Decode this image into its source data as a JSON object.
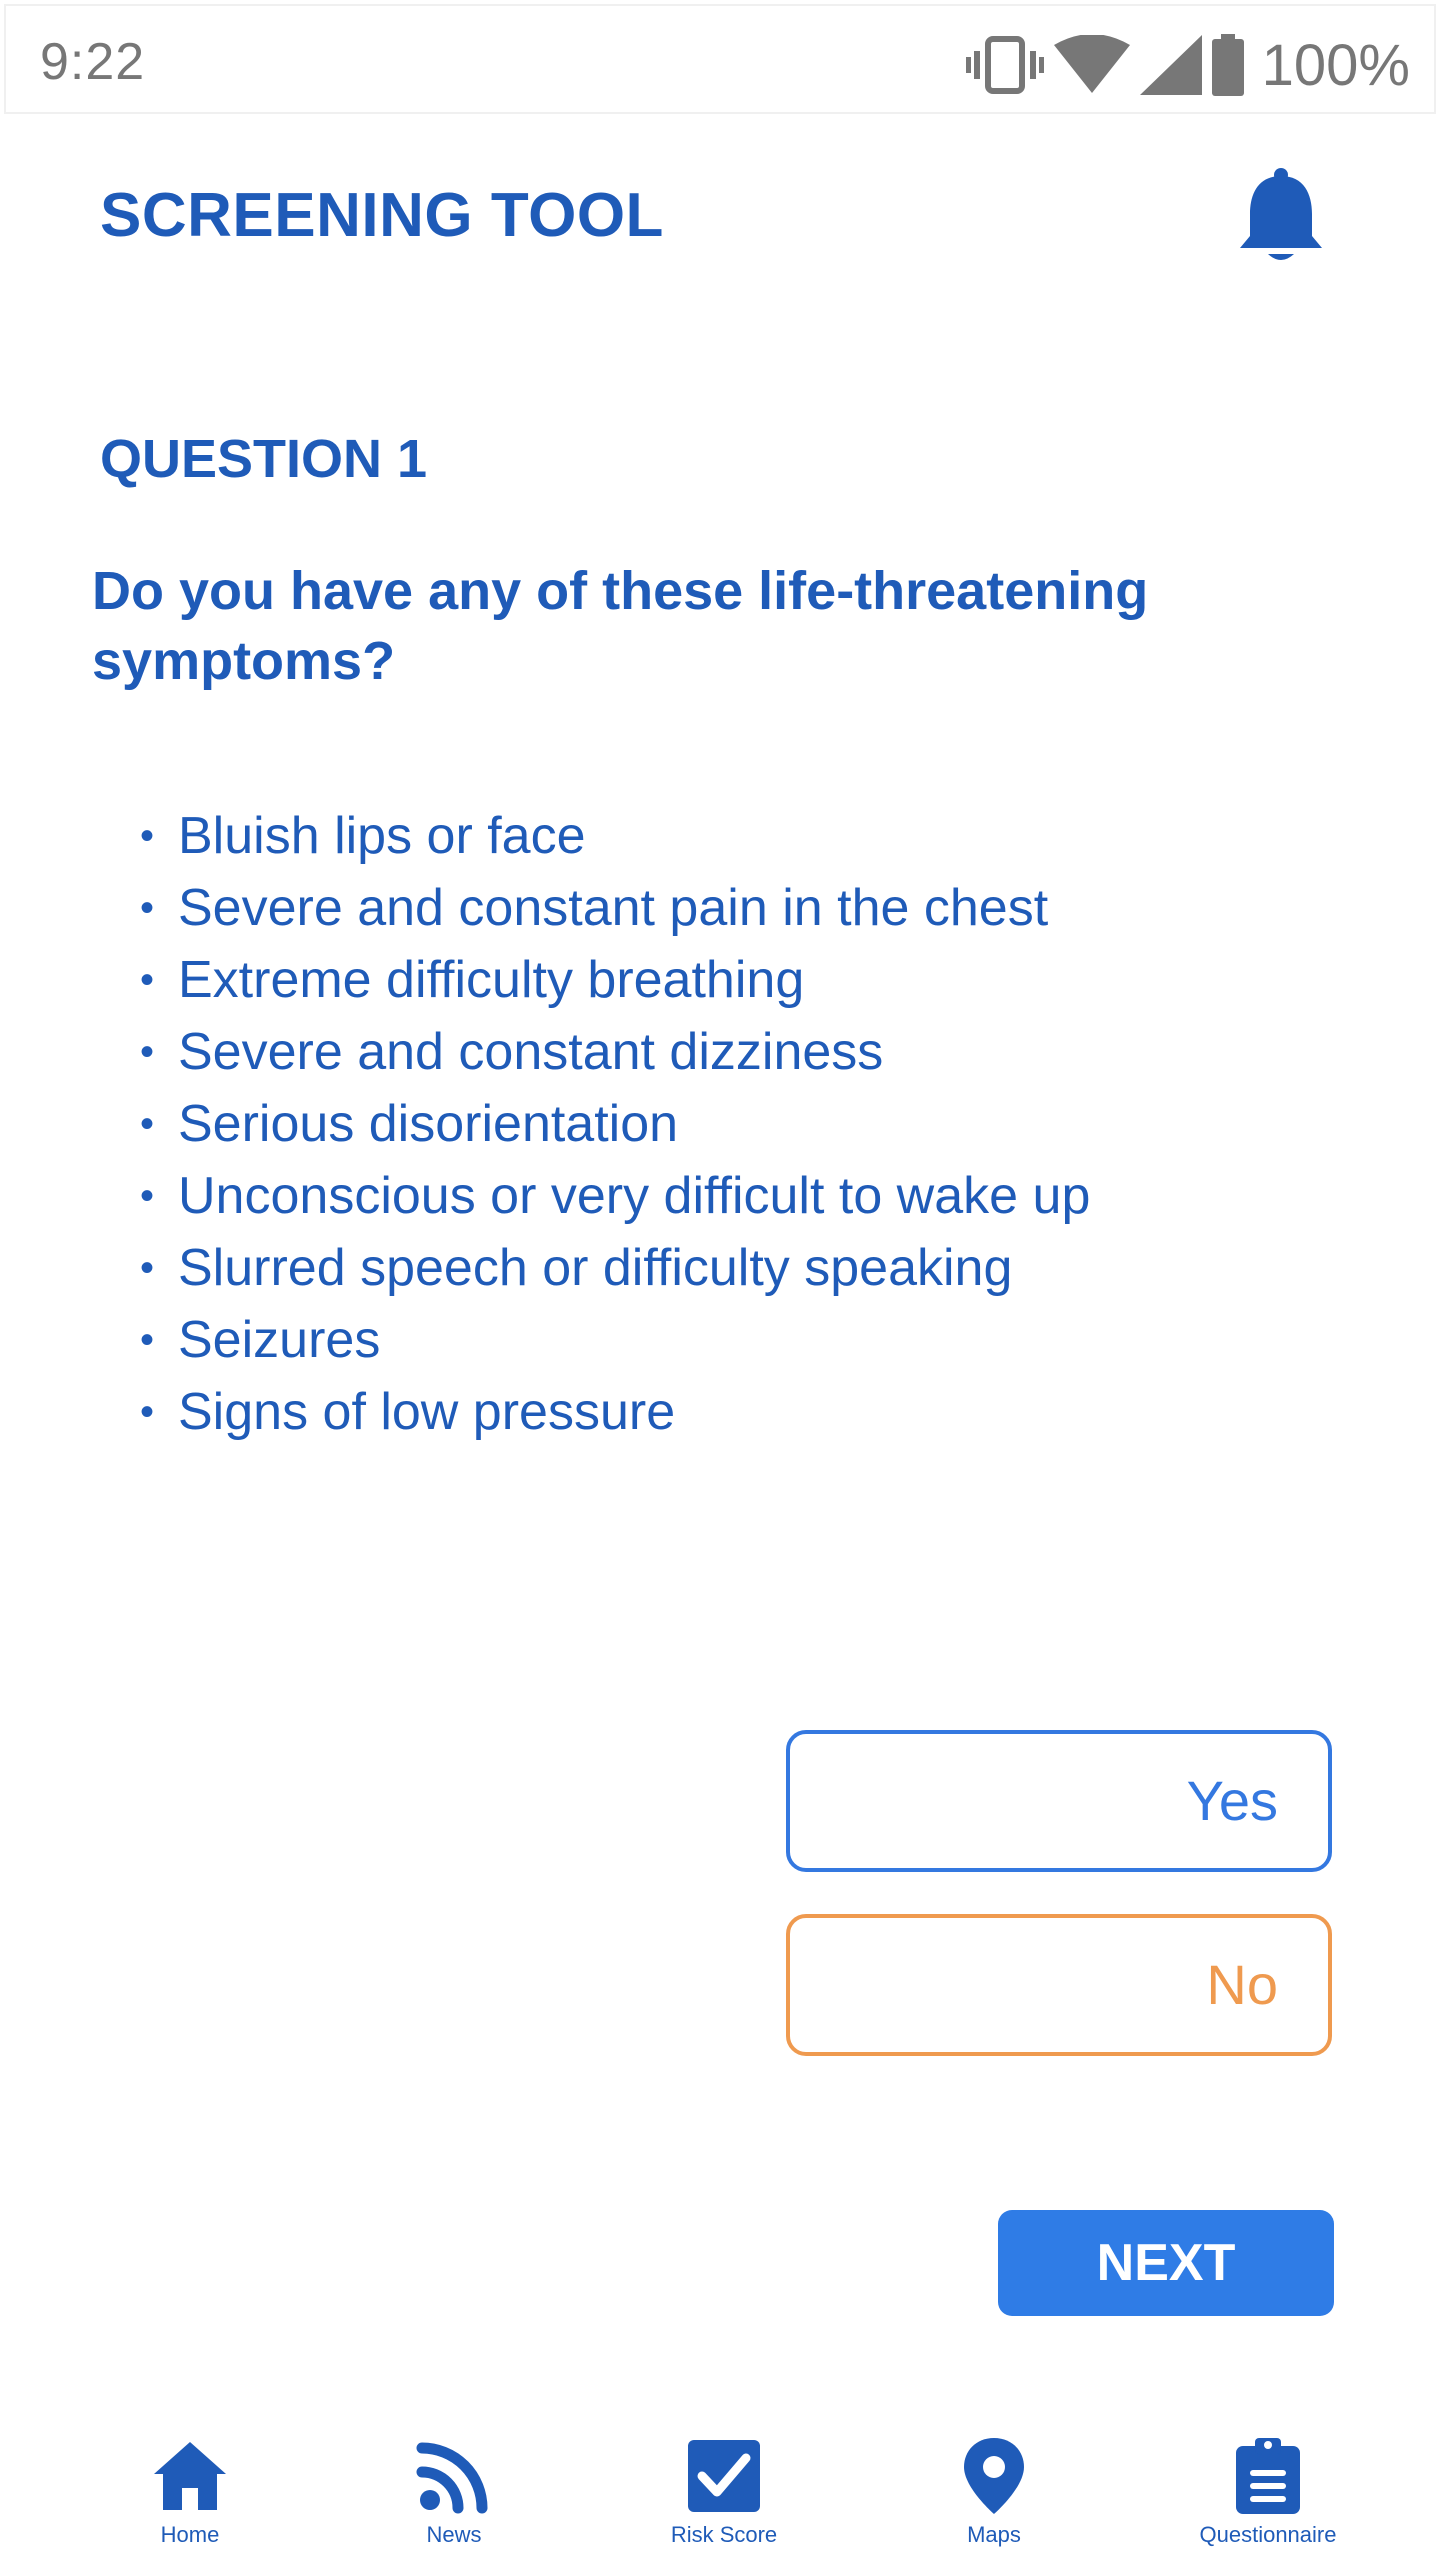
{
  "status_bar": {
    "time": "9:22",
    "battery": "100%"
  },
  "header": {
    "title": "SCREENING TOOL"
  },
  "question": {
    "number_label": "QUESTION 1",
    "text": "Do you have any of these life-threatening symptoms?",
    "symptoms": [
      "Bluish lips or face",
      "Severe and constant pain in the chest",
      "Extreme difficulty breathing",
      "Severe and constant dizziness",
      "Serious disorientation",
      "Unconscious or very difficult to wake up",
      "Slurred speech or difficulty speaking",
      "Seizures",
      "Signs of low pressure"
    ]
  },
  "answers": {
    "yes_label": "Yes",
    "no_label": "No"
  },
  "actions": {
    "next_label": "NEXT"
  },
  "bottom_nav": [
    {
      "label": "Home",
      "icon": "home-icon"
    },
    {
      "label": "News",
      "icon": "rss-icon"
    },
    {
      "label": "Risk Score",
      "icon": "checkbox-icon"
    },
    {
      "label": "Maps",
      "icon": "map-pin-icon"
    },
    {
      "label": "Questionnaire",
      "icon": "clipboard-icon"
    }
  ],
  "colors": {
    "primary": "#1f5bb8",
    "yes": "#3478e0",
    "no": "#ef9a4f",
    "next_button": "#2f7ce6",
    "status_text": "#777777"
  }
}
